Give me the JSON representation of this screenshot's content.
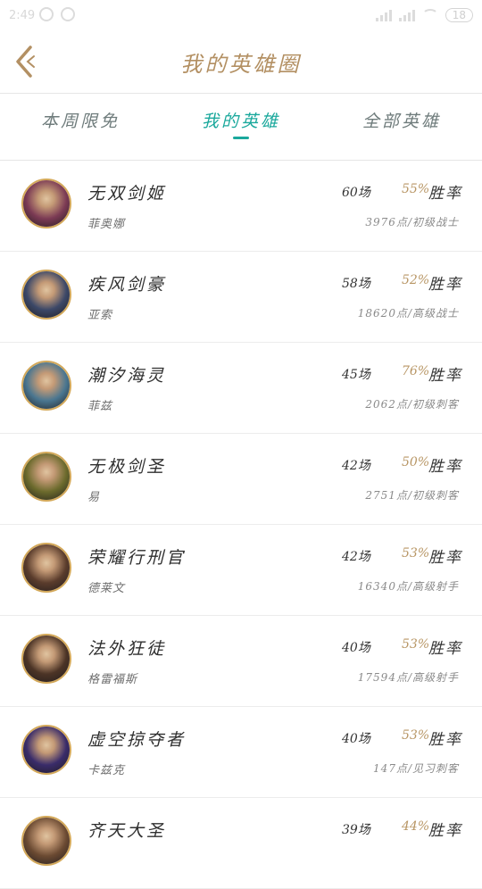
{
  "status_bar": {
    "time": "2:49",
    "battery": "18"
  },
  "header": {
    "title": "我的英雄圈"
  },
  "tabs": [
    {
      "label": "本周限免",
      "active": false
    },
    {
      "label": "我的英雄",
      "active": true
    },
    {
      "label": "全部英雄",
      "active": false
    }
  ],
  "rate_label": "胜率",
  "heroes": [
    {
      "name": "无双剑姬",
      "title": "菲奥娜",
      "games": "60场",
      "rate": "55%",
      "level": "3976点/初级战士",
      "avatar_color": "#7b3a54"
    },
    {
      "name": "疾风剑豪",
      "title": "亚索",
      "games": "58场",
      "rate": "52%",
      "level": "18620点/高级战士",
      "avatar_color": "#3c4868"
    },
    {
      "name": "潮汐海灵",
      "title": "菲兹",
      "games": "45场",
      "rate": "76%",
      "level": "2062点/初级刺客",
      "avatar_color": "#4a7690"
    },
    {
      "name": "无极剑圣",
      "title": "易",
      "games": "42场",
      "rate": "50%",
      "level": "2751点/初级刺客",
      "avatar_color": "#6b6a2c"
    },
    {
      "name": "荣耀行刑官",
      "title": "德莱文",
      "games": "42场",
      "rate": "53%",
      "level": "16340点/高级射手",
      "avatar_color": "#5a3c2c"
    },
    {
      "name": "法外狂徒",
      "title": "格雷福斯",
      "games": "40场",
      "rate": "53%",
      "level": "17594点/高级射手",
      "avatar_color": "#4c3426"
    },
    {
      "name": "虚空掠夺者",
      "title": "卡兹克",
      "games": "40场",
      "rate": "53%",
      "level": "147点/见习刺客",
      "avatar_color": "#3a2c6a"
    },
    {
      "name": "齐天大圣",
      "title": "",
      "games": "39场",
      "rate": "44%",
      "level": "",
      "avatar_color": "#6b4a32"
    }
  ]
}
